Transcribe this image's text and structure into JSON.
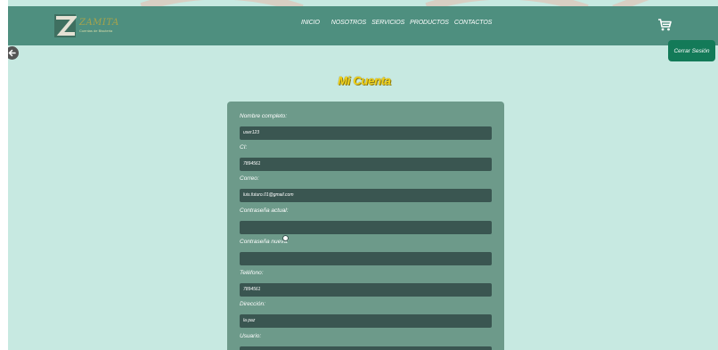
{
  "header": {
    "logo_title": "ZAMITA",
    "logo_subtitle": "Cuentas de Bisuteria",
    "nav": [
      "INICIO",
      "NOSOTROS",
      "SERVICIOS",
      "PRODUCTOS",
      "CONTACTOS"
    ],
    "cart_icon": "cart-icon"
  },
  "logout_label": "Cerrar Sesión",
  "page_title": "Mi Cuenta",
  "form": {
    "fields": [
      {
        "label": "Nombre completo:",
        "value": "user123"
      },
      {
        "label": "CI:",
        "value": "7894561"
      },
      {
        "label": "Correo:",
        "value": "luis.futuro.01@gmail.com"
      },
      {
        "label": "Contraseña actual:",
        "value": ""
      },
      {
        "label": "Contraseña nueva:",
        "value": ""
      },
      {
        "label": "Teléfono:",
        "value": "7894561"
      },
      {
        "label": "Dirección:",
        "value": "la paz"
      },
      {
        "label": "Usuario:",
        "value": ""
      }
    ]
  },
  "colors": {
    "background": "#c7e9e1",
    "header": "#4e8f7f",
    "card": "#6d9a8a",
    "input": "#3a5651",
    "title": "#f2d21a",
    "logout": "#137a58"
  }
}
